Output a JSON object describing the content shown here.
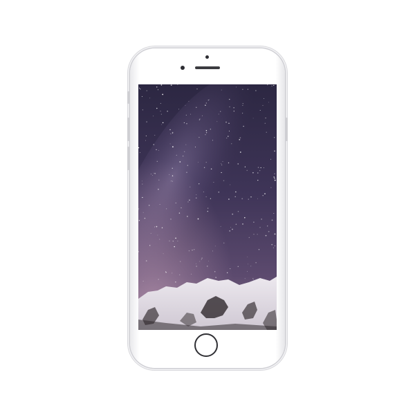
{
  "device": {
    "model": "iphone-6",
    "color": "silver-white",
    "frame_color": "#ffffff",
    "bezel_color": "#ffffff"
  },
  "screen": {
    "state": "wallpaper",
    "wallpaper": "night-sky-milky-way-over-snowy-mountain",
    "colors": {
      "sky_top": "#2f2946",
      "sky_mid": "#4b3f66",
      "sky_glow": "#9a7f9c",
      "snow": "#e6e2e8",
      "rock": "#3a3438"
    }
  },
  "icons": {
    "home_button": "home-button",
    "camera": "front-camera",
    "speaker": "earpiece-speaker"
  }
}
